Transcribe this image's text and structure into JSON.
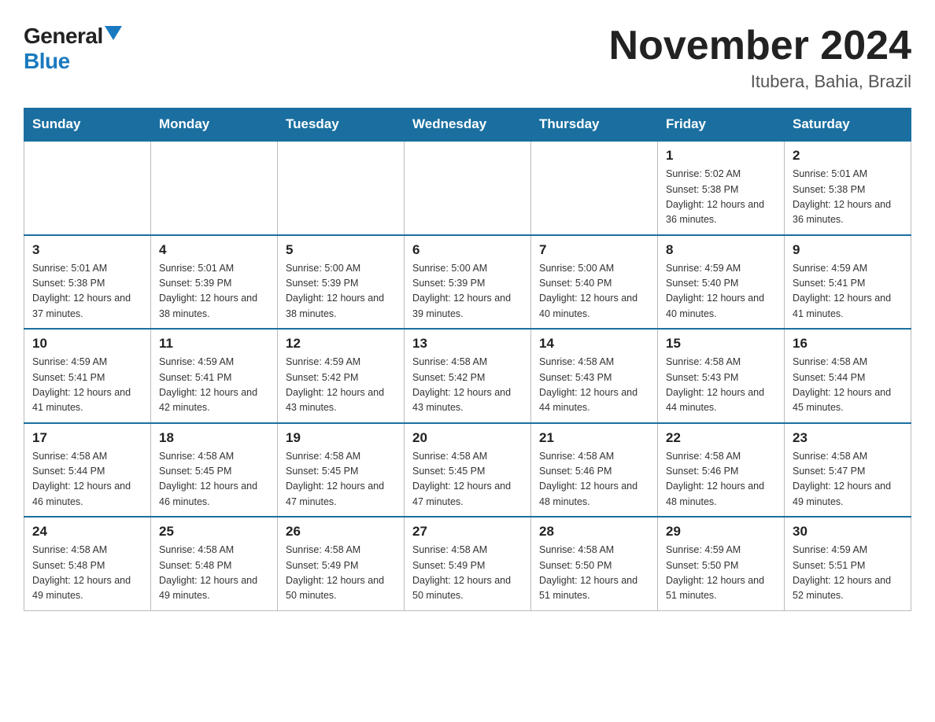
{
  "header": {
    "logo_general": "General",
    "logo_blue": "Blue",
    "month_title": "November 2024",
    "location": "Itubera, Bahia, Brazil"
  },
  "weekdays": [
    "Sunday",
    "Monday",
    "Tuesday",
    "Wednesday",
    "Thursday",
    "Friday",
    "Saturday"
  ],
  "weeks": [
    [
      {
        "day": "",
        "sunrise": "",
        "sunset": "",
        "daylight": ""
      },
      {
        "day": "",
        "sunrise": "",
        "sunset": "",
        "daylight": ""
      },
      {
        "day": "",
        "sunrise": "",
        "sunset": "",
        "daylight": ""
      },
      {
        "day": "",
        "sunrise": "",
        "sunset": "",
        "daylight": ""
      },
      {
        "day": "",
        "sunrise": "",
        "sunset": "",
        "daylight": ""
      },
      {
        "day": "1",
        "sunrise": "Sunrise: 5:02 AM",
        "sunset": "Sunset: 5:38 PM",
        "daylight": "Daylight: 12 hours and 36 minutes."
      },
      {
        "day": "2",
        "sunrise": "Sunrise: 5:01 AM",
        "sunset": "Sunset: 5:38 PM",
        "daylight": "Daylight: 12 hours and 36 minutes."
      }
    ],
    [
      {
        "day": "3",
        "sunrise": "Sunrise: 5:01 AM",
        "sunset": "Sunset: 5:38 PM",
        "daylight": "Daylight: 12 hours and 37 minutes."
      },
      {
        "day": "4",
        "sunrise": "Sunrise: 5:01 AM",
        "sunset": "Sunset: 5:39 PM",
        "daylight": "Daylight: 12 hours and 38 minutes."
      },
      {
        "day": "5",
        "sunrise": "Sunrise: 5:00 AM",
        "sunset": "Sunset: 5:39 PM",
        "daylight": "Daylight: 12 hours and 38 minutes."
      },
      {
        "day": "6",
        "sunrise": "Sunrise: 5:00 AM",
        "sunset": "Sunset: 5:39 PM",
        "daylight": "Daylight: 12 hours and 39 minutes."
      },
      {
        "day": "7",
        "sunrise": "Sunrise: 5:00 AM",
        "sunset": "Sunset: 5:40 PM",
        "daylight": "Daylight: 12 hours and 40 minutes."
      },
      {
        "day": "8",
        "sunrise": "Sunrise: 4:59 AM",
        "sunset": "Sunset: 5:40 PM",
        "daylight": "Daylight: 12 hours and 40 minutes."
      },
      {
        "day": "9",
        "sunrise": "Sunrise: 4:59 AM",
        "sunset": "Sunset: 5:41 PM",
        "daylight": "Daylight: 12 hours and 41 minutes."
      }
    ],
    [
      {
        "day": "10",
        "sunrise": "Sunrise: 4:59 AM",
        "sunset": "Sunset: 5:41 PM",
        "daylight": "Daylight: 12 hours and 41 minutes."
      },
      {
        "day": "11",
        "sunrise": "Sunrise: 4:59 AM",
        "sunset": "Sunset: 5:41 PM",
        "daylight": "Daylight: 12 hours and 42 minutes."
      },
      {
        "day": "12",
        "sunrise": "Sunrise: 4:59 AM",
        "sunset": "Sunset: 5:42 PM",
        "daylight": "Daylight: 12 hours and 43 minutes."
      },
      {
        "day": "13",
        "sunrise": "Sunrise: 4:58 AM",
        "sunset": "Sunset: 5:42 PM",
        "daylight": "Daylight: 12 hours and 43 minutes."
      },
      {
        "day": "14",
        "sunrise": "Sunrise: 4:58 AM",
        "sunset": "Sunset: 5:43 PM",
        "daylight": "Daylight: 12 hours and 44 minutes."
      },
      {
        "day": "15",
        "sunrise": "Sunrise: 4:58 AM",
        "sunset": "Sunset: 5:43 PM",
        "daylight": "Daylight: 12 hours and 44 minutes."
      },
      {
        "day": "16",
        "sunrise": "Sunrise: 4:58 AM",
        "sunset": "Sunset: 5:44 PM",
        "daylight": "Daylight: 12 hours and 45 minutes."
      }
    ],
    [
      {
        "day": "17",
        "sunrise": "Sunrise: 4:58 AM",
        "sunset": "Sunset: 5:44 PM",
        "daylight": "Daylight: 12 hours and 46 minutes."
      },
      {
        "day": "18",
        "sunrise": "Sunrise: 4:58 AM",
        "sunset": "Sunset: 5:45 PM",
        "daylight": "Daylight: 12 hours and 46 minutes."
      },
      {
        "day": "19",
        "sunrise": "Sunrise: 4:58 AM",
        "sunset": "Sunset: 5:45 PM",
        "daylight": "Daylight: 12 hours and 47 minutes."
      },
      {
        "day": "20",
        "sunrise": "Sunrise: 4:58 AM",
        "sunset": "Sunset: 5:45 PM",
        "daylight": "Daylight: 12 hours and 47 minutes."
      },
      {
        "day": "21",
        "sunrise": "Sunrise: 4:58 AM",
        "sunset": "Sunset: 5:46 PM",
        "daylight": "Daylight: 12 hours and 48 minutes."
      },
      {
        "day": "22",
        "sunrise": "Sunrise: 4:58 AM",
        "sunset": "Sunset: 5:46 PM",
        "daylight": "Daylight: 12 hours and 48 minutes."
      },
      {
        "day": "23",
        "sunrise": "Sunrise: 4:58 AM",
        "sunset": "Sunset: 5:47 PM",
        "daylight": "Daylight: 12 hours and 49 minutes."
      }
    ],
    [
      {
        "day": "24",
        "sunrise": "Sunrise: 4:58 AM",
        "sunset": "Sunset: 5:48 PM",
        "daylight": "Daylight: 12 hours and 49 minutes."
      },
      {
        "day": "25",
        "sunrise": "Sunrise: 4:58 AM",
        "sunset": "Sunset: 5:48 PM",
        "daylight": "Daylight: 12 hours and 49 minutes."
      },
      {
        "day": "26",
        "sunrise": "Sunrise: 4:58 AM",
        "sunset": "Sunset: 5:49 PM",
        "daylight": "Daylight: 12 hours and 50 minutes."
      },
      {
        "day": "27",
        "sunrise": "Sunrise: 4:58 AM",
        "sunset": "Sunset: 5:49 PM",
        "daylight": "Daylight: 12 hours and 50 minutes."
      },
      {
        "day": "28",
        "sunrise": "Sunrise: 4:58 AM",
        "sunset": "Sunset: 5:50 PM",
        "daylight": "Daylight: 12 hours and 51 minutes."
      },
      {
        "day": "29",
        "sunrise": "Sunrise: 4:59 AM",
        "sunset": "Sunset: 5:50 PM",
        "daylight": "Daylight: 12 hours and 51 minutes."
      },
      {
        "day": "30",
        "sunrise": "Sunrise: 4:59 AM",
        "sunset": "Sunset: 5:51 PM",
        "daylight": "Daylight: 12 hours and 52 minutes."
      }
    ]
  ]
}
